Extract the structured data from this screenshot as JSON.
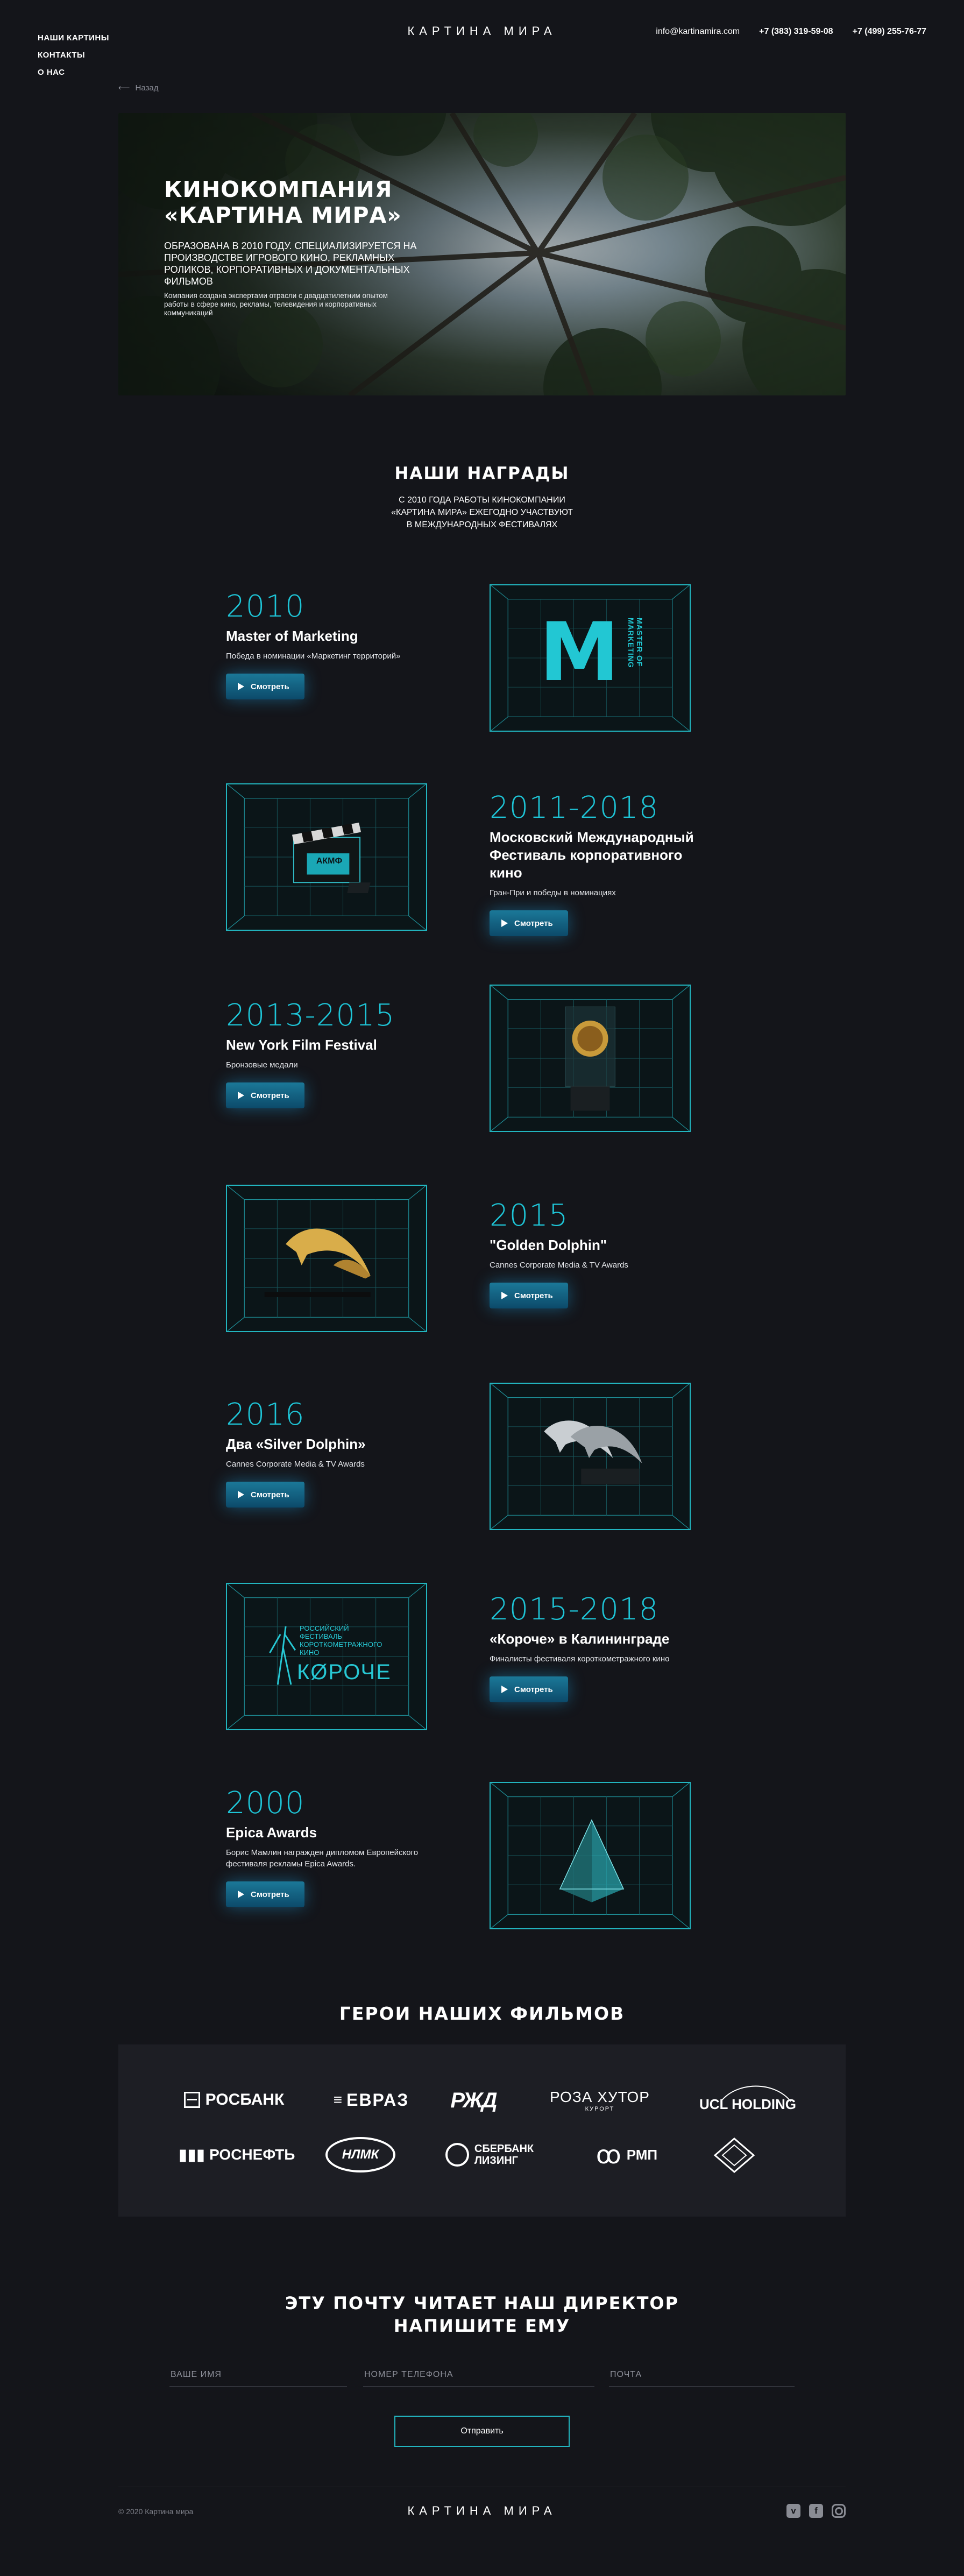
{
  "header": {
    "nav": [
      "НАШИ КАРТИНЫ",
      "КОНТАКТЫ",
      "О НАС"
    ],
    "brand": "КАРТИНА МИРА",
    "email": "info@kartinamira.com",
    "phone1": "+7 (383) 319-59-08",
    "phone2": "+7 (499) 255-76-77"
  },
  "back_label": "Назад",
  "hero": {
    "title": "КИНОКОМПАНИЯ\n«КАРТИНА МИРА»",
    "subtitle": "ОБРАЗОВАНА В 2010 ГОДУ. СПЕЦИАЛИЗИРУЕТСЯ НА ПРОИЗВОДСТВЕ ИГРОВОГО КИНО, РЕКЛАМНЫХ РОЛИКОВ, КОРПОРАТИВНЫХ И ДОКУМЕНТАЛЬНЫХ ФИЛЬМОВ",
    "note": "Компания создана экспертами отрасли с двадцатилетним опытом работы в сфере кино, рекламы, телевидения и корпоративных коммуникаций"
  },
  "awards": {
    "title": "НАШИ НАГРАДЫ",
    "subtitle_lines": [
      "С 2010 ГОДА РАБОТЫ КИНОКОМПАНИИ",
      "«КАРТИНА МИРА» ЕЖЕГОДНО УЧАСТВУЮТ",
      "В МЕЖДУНАРОДНЫХ ФЕСТИВАЛЯХ"
    ],
    "watch_label": "Смотреть",
    "items": [
      {
        "year": "2010",
        "name": "Master of Marketing",
        "desc": "Победа в номинации «Маркетинг территорий»",
        "icon": "master-of-marketing-logo"
      },
      {
        "year": "2011-2018",
        "name": "Московский Международный Фестиваль корпоративного кино",
        "desc": "Гран-При и победы в номинациях",
        "icon": "clapperboard-trophy"
      },
      {
        "year": "2013-2015",
        "name": "New York Film Festival",
        "desc": "Бронзовые медали",
        "icon": "bronze-medal"
      },
      {
        "year": "2015",
        "name": "\"Golden Dolphin\"",
        "desc": "Cannes Corporate Media & TV Awards",
        "icon": "golden-dolphin"
      },
      {
        "year": "2016",
        "name": "Два «Silver Dolphin»",
        "desc": "Cannes Corporate Media & TV Awards",
        "icon": "silver-dolphins"
      },
      {
        "year": "2015-2018",
        "name": "«Короче» в Калининграде",
        "desc": "Финалисты фестиваля короткометражного кино",
        "icon": "korotche-logo"
      },
      {
        "year": "2000",
        "name": "Epica Awards",
        "desc": "Борис Мамлин награжден дипломом Европейского фестиваля рекламы Epica Awards.",
        "icon": "glass-pyramid"
      }
    ],
    "mm_logo_text": [
      "MASTER OF",
      "MARKETING"
    ],
    "mm_logo_letter": "M",
    "korotche_text": [
      "РОССИЙСКИЙ",
      "ФЕСТИВАЛЬ",
      "КОРОТКОМЕТРАЖНОГО",
      "КИНО"
    ],
    "korotche_word": "КØРОЧЕ",
    "clapper_text": "АКМФ"
  },
  "heroes": {
    "title": "ГЕРОИ НАШИХ ФИЛЬМОВ",
    "logos": [
      "РОСБАНК",
      "ЕВРАЗ",
      "РЖД",
      "РОЗА ХУТОР",
      "UCL HOLDING",
      "РОСНЕФТЬ",
      "НЛМК",
      "СБЕРБАНК ЛИЗИНГ",
      "РМП",
      "ромб-логотип"
    ],
    "roza_sub": "КУРОРТ",
    "sber_lines": [
      "СБЕРБАНК",
      "ЛИЗИНГ"
    ]
  },
  "contact": {
    "title": "ЭТУ ПОЧТУ ЧИТАЕТ НАШ ДИРЕКТОР\nНАПИШИТЕ ЕМУ",
    "name_placeholder": "ВАШЕ ИМЯ",
    "phone_placeholder": "НОМЕР ТЕЛЕФОНА",
    "email_placeholder": "ПОЧТА",
    "submit_label": "Отправить"
  },
  "footer": {
    "copyright": "© 2020 Картина мира",
    "brand": "КАРТИНА МИРА"
  },
  "colors": {
    "background": "#14151a",
    "accent_cyan": "#1ec4d6",
    "button_blue": "#1b7898",
    "panel": "#1d1e24"
  }
}
